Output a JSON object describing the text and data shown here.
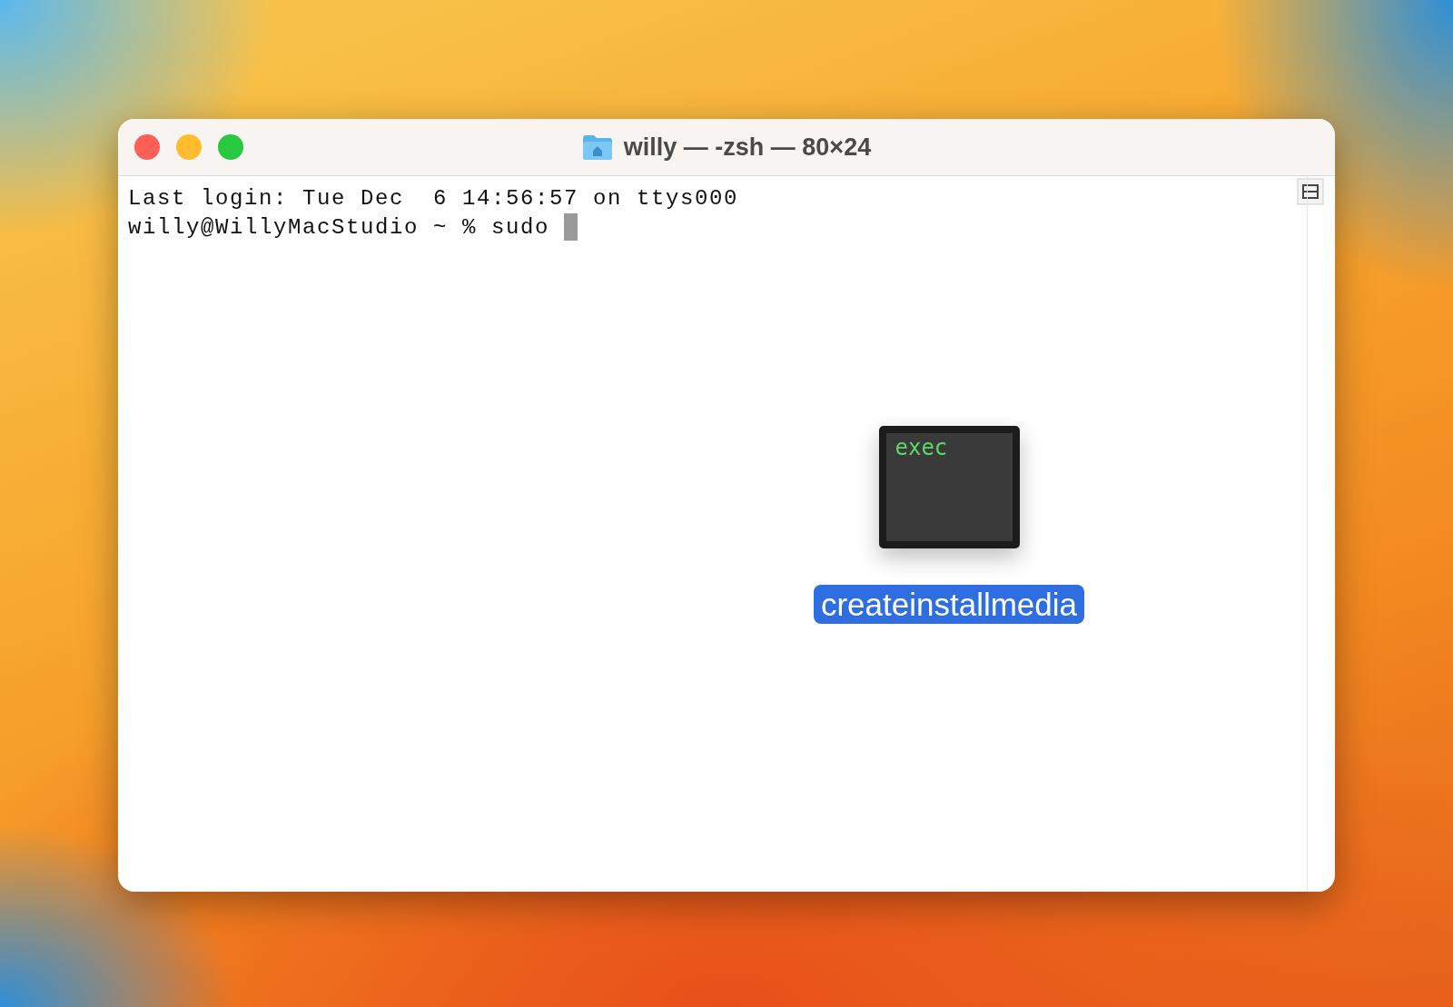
{
  "window": {
    "title": "willy — -zsh — 80×24"
  },
  "terminal": {
    "lines": [
      {
        "text": "Last login: Tue Dec  6 14:56:57 on ttys000",
        "cursor": false
      },
      {
        "text": "willy@WillyMacStudio ~ % sudo ",
        "cursor": true
      }
    ]
  },
  "dragged_file": {
    "icon_text": "exec",
    "name": "createinstallmedia",
    "selected": true
  }
}
